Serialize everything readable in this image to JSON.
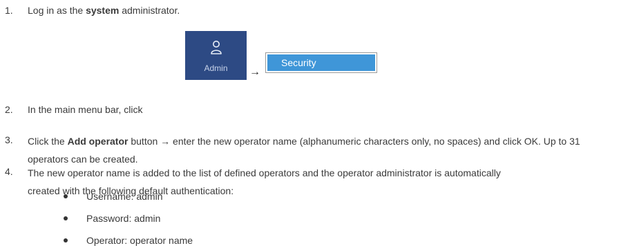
{
  "steps": [
    {
      "num": "1.",
      "pre": "Log in as the ",
      "bold": "system",
      "post": " administrator."
    },
    {
      "num": "2.",
      "text": "In the main menu bar, click"
    },
    {
      "num": "3.",
      "pre": "Click the ",
      "bold": "Add operator",
      "post": " button → enter the new operator name (alphanumeric characters only, no spaces) and click OK. Up to 31 operators can be created."
    },
    {
      "num": "4.",
      "text": "The new operator name is added to the list of defined operators and the operator administrator is automatically created with the following default authentication:"
    }
  ],
  "admin_button": {
    "label": "Admin",
    "icon": "user-icon",
    "color": "#2d4a84"
  },
  "arrow": "→",
  "security_button": {
    "label": "Security",
    "color": "#3f96d8"
  },
  "bullets": [
    "Username: admin",
    "Password: admin",
    "Operator: operator name"
  ]
}
